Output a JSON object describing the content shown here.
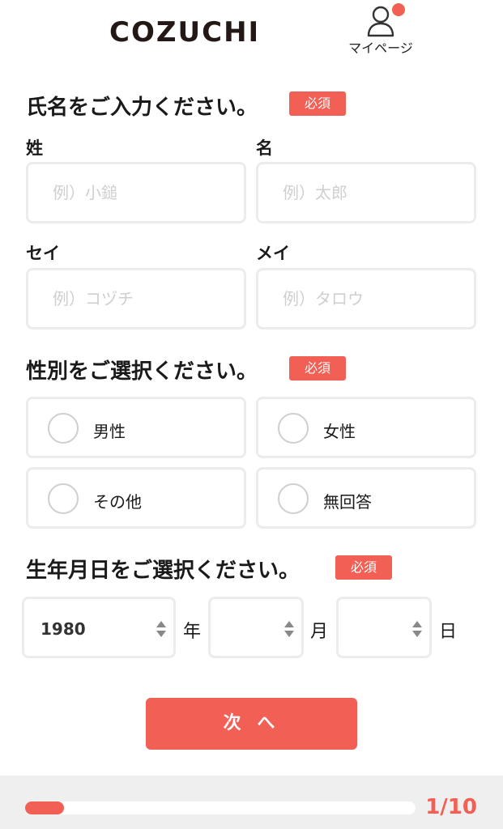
{
  "header": {
    "logo": "COZUCHI",
    "mypage_label": "マイページ",
    "has_notification": true
  },
  "name_section": {
    "title": "氏名をご入力ください。",
    "required_badge": "必須",
    "fields": {
      "last_name": {
        "label": "姓",
        "placeholder": "例）小鎚",
        "value": ""
      },
      "first_name": {
        "label": "名",
        "placeholder": "例）太郎",
        "value": ""
      },
      "last_name_kana": {
        "label": "セイ",
        "placeholder": "例）コヅチ",
        "value": ""
      },
      "first_name_kana": {
        "label": "メイ",
        "placeholder": "例）タロウ",
        "value": ""
      }
    }
  },
  "gender_section": {
    "title": "性別をご選択ください。",
    "required_badge": "必須",
    "options": [
      "男性",
      "女性",
      "その他",
      "無回答"
    ]
  },
  "birthdate_section": {
    "title": "生年月日をご選択ください。",
    "required_badge": "必須",
    "year": {
      "value": "1980",
      "unit": "年"
    },
    "month": {
      "value": "",
      "unit": "月"
    },
    "day": {
      "value": "",
      "unit": "日"
    }
  },
  "next_button": {
    "label": "次 へ"
  },
  "progress": {
    "text": "1/10",
    "current": 1,
    "total": 10
  },
  "colors": {
    "accent": "#f25f55",
    "border": "#ececec",
    "footer_bg": "#efefef"
  }
}
